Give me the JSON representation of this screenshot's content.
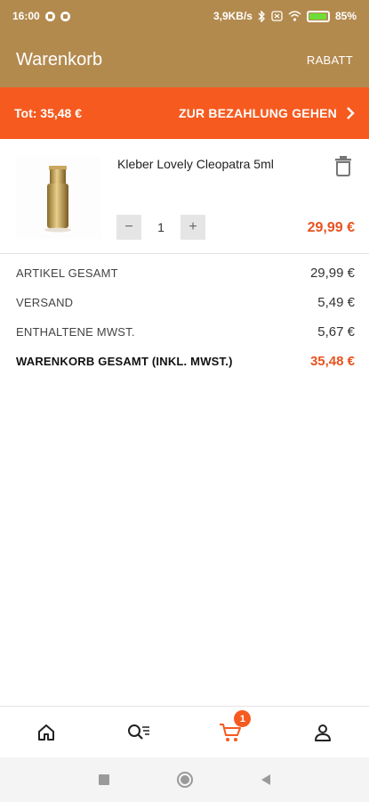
{
  "status_bar": {
    "time": "16:00",
    "network_speed": "3,9KB/s",
    "battery": "85%",
    "battery_level": 0.85
  },
  "header": {
    "title": "Warenkorb",
    "action": "RABATT"
  },
  "checkout_bar": {
    "total": "Tot: 35,48 €",
    "button_label": "ZUR BEZAHLUNG GEHEN"
  },
  "cart_item": {
    "title": "Kleber Lovely Cleopatra 5ml",
    "quantity": "1",
    "minus": "−",
    "plus": "+",
    "price": "29,99 €"
  },
  "summary": {
    "rows": [
      {
        "label": "ARTIKEL GESAMT",
        "value": "29,99 €"
      },
      {
        "label": "VERSAND",
        "value": "5,49 €"
      },
      {
        "label": "ENTHALTENE MWST.",
        "value": "5,67 €"
      }
    ],
    "total": {
      "label": "WARENKORB GESAMT (INKL. MWST.)",
      "value": "35,48 €"
    }
  },
  "bottom_nav": {
    "cart_badge": "1",
    "accent": "#f65a1f",
    "icons": [
      "home-icon",
      "search-list-icon",
      "cart-icon",
      "user-icon"
    ]
  },
  "colors": {
    "brand": "#b38a4e",
    "accent": "#f65a1f",
    "price": "#e8531f"
  }
}
